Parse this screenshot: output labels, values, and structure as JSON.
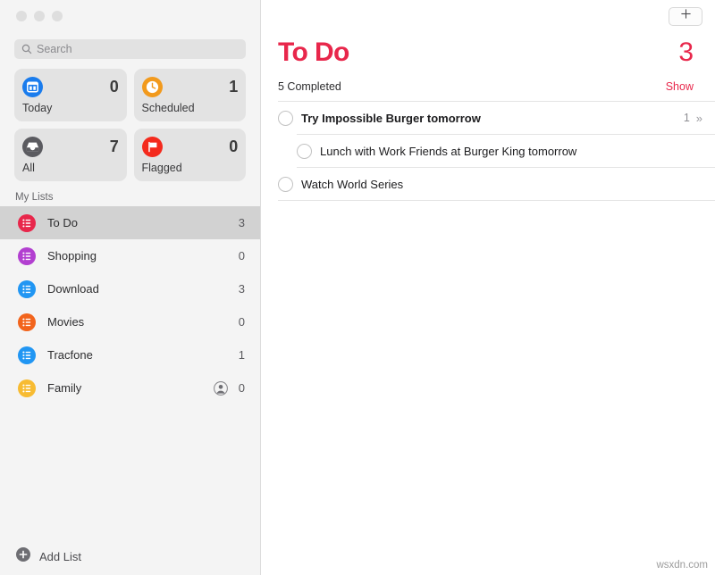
{
  "window": {
    "traffic_lights": [
      "close",
      "minimize",
      "zoom"
    ]
  },
  "colors": {
    "accent_red": "#e8274b",
    "sidebar_bg": "#f4f4f4",
    "selected_row": "#d2d2d2",
    "card_bg": "#e3e3e3",
    "today_blue": "#1a7ced",
    "scheduled_orange": "#f29a1d",
    "all_gray": "#5b5b60",
    "flagged_red": "#f42a1d",
    "shopping_purple": "#b23fd0",
    "download_blue": "#2196f3",
    "movies_orange": "#f2641c",
    "tracfone_blue": "#2196f3",
    "family_yellow": "#f7bb32"
  },
  "sidebar": {
    "search": {
      "placeholder": "Search",
      "value": "",
      "icon": "search-icon"
    },
    "smart_lists": [
      {
        "key": "today",
        "label": "Today",
        "count": "0",
        "icon": "calendar-icon",
        "color": "#1a7ced"
      },
      {
        "key": "scheduled",
        "label": "Scheduled",
        "count": "1",
        "icon": "clock-icon",
        "color": "#f29a1d"
      },
      {
        "key": "all",
        "label": "All",
        "count": "7",
        "icon": "inbox-icon",
        "color": "#5b5b60"
      },
      {
        "key": "flagged",
        "label": "Flagged",
        "count": "0",
        "icon": "flag-icon",
        "color": "#f42a1d"
      }
    ],
    "my_lists_header": "My Lists",
    "my_lists": [
      {
        "key": "todo",
        "label": "To Do",
        "count": "3",
        "color": "#e8274b",
        "selected": true,
        "shared": false
      },
      {
        "key": "shopping",
        "label": "Shopping",
        "count": "0",
        "color": "#b23fd0",
        "selected": false,
        "shared": false
      },
      {
        "key": "download",
        "label": "Download",
        "count": "3",
        "color": "#2196f3",
        "selected": false,
        "shared": false
      },
      {
        "key": "movies",
        "label": "Movies",
        "count": "0",
        "color": "#f2641c",
        "selected": false,
        "shared": false
      },
      {
        "key": "tracfone",
        "label": "Tracfone",
        "count": "1",
        "color": "#2196f3",
        "selected": false,
        "shared": false
      },
      {
        "key": "family",
        "label": "Family",
        "count": "0",
        "color": "#f7bb32",
        "selected": false,
        "shared": true
      }
    ],
    "add_list_label": "Add List",
    "add_list_icon": "plus-circle-icon"
  },
  "main": {
    "add_task_icon": "plus-icon",
    "title": "To Do",
    "title_count": "3",
    "completed_label": "5 Completed",
    "show_label": "Show",
    "tasks": [
      {
        "key": "task-1",
        "title": "Try Impossible Burger tomorrow",
        "bold": true,
        "sub": false,
        "subtask_count": "1",
        "chevron": "»",
        "checked": false
      },
      {
        "key": "task-2",
        "title": "Lunch with Work Friends at Burger King tomorrow",
        "bold": false,
        "sub": true,
        "subtask_count": "",
        "chevron": "",
        "checked": false
      },
      {
        "key": "task-3",
        "title": "Watch World Series",
        "bold": false,
        "sub": false,
        "subtask_count": "",
        "chevron": "",
        "checked": false
      }
    ]
  },
  "watermark": "wsxdn.com"
}
